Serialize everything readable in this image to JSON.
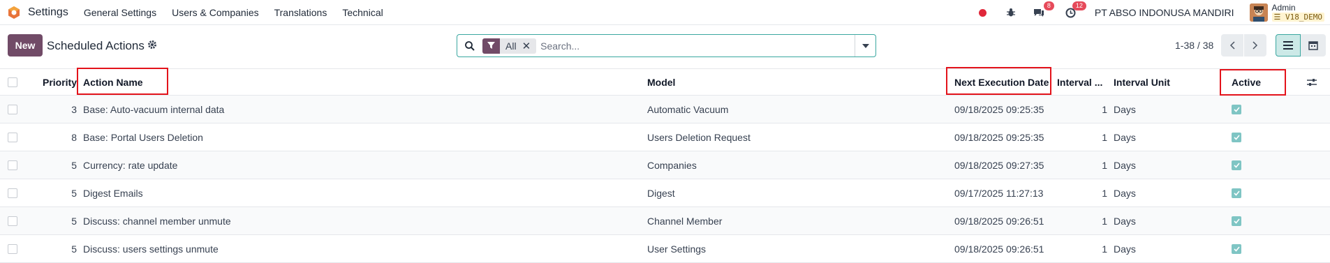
{
  "navbar": {
    "app_title": "Settings",
    "menu": [
      "General Settings",
      "Users & Companies",
      "Translations",
      "Technical"
    ],
    "messages_count": "8",
    "activities_count": "12",
    "company": "PT ABSO INDONUSA MANDIRI",
    "user_name": "Admin",
    "db_name": "V18_DEMO"
  },
  "control": {
    "new_label": "New",
    "title": "Scheduled Actions",
    "search": {
      "facet": "All",
      "placeholder": "Search..."
    },
    "pager": "1-38 / 38"
  },
  "table": {
    "columns": {
      "priority": "Priority",
      "name": "Action Name",
      "model": "Model",
      "next": "Next Execution Date",
      "interval": "Interval ...",
      "unit": "Interval Unit",
      "active": "Active"
    },
    "rows": [
      {
        "priority": "3",
        "name": "Base: Auto-vacuum internal data",
        "model": "Automatic Vacuum",
        "next": "09/18/2025 09:25:35",
        "interval": "1",
        "unit": "Days",
        "active": true
      },
      {
        "priority": "8",
        "name": "Base: Portal Users Deletion",
        "model": "Users Deletion Request",
        "next": "09/18/2025 09:25:35",
        "interval": "1",
        "unit": "Days",
        "active": true
      },
      {
        "priority": "5",
        "name": "Currency: rate update",
        "model": "Companies",
        "next": "09/18/2025 09:27:35",
        "interval": "1",
        "unit": "Days",
        "active": true
      },
      {
        "priority": "5",
        "name": "Digest Emails",
        "model": "Digest",
        "next": "09/17/2025 11:27:13",
        "interval": "1",
        "unit": "Days",
        "active": true
      },
      {
        "priority": "5",
        "name": "Discuss: channel member unmute",
        "model": "Channel Member",
        "next": "09/18/2025 09:26:51",
        "interval": "1",
        "unit": "Days",
        "active": true
      },
      {
        "priority": "5",
        "name": "Discuss: users settings unmute",
        "model": "User Settings",
        "next": "09/18/2025 09:26:51",
        "interval": "1",
        "unit": "Days",
        "active": true
      }
    ]
  },
  "colors": {
    "brand": "#714b67",
    "accent": "#3aa7a0",
    "highlight": "#e3131b"
  }
}
